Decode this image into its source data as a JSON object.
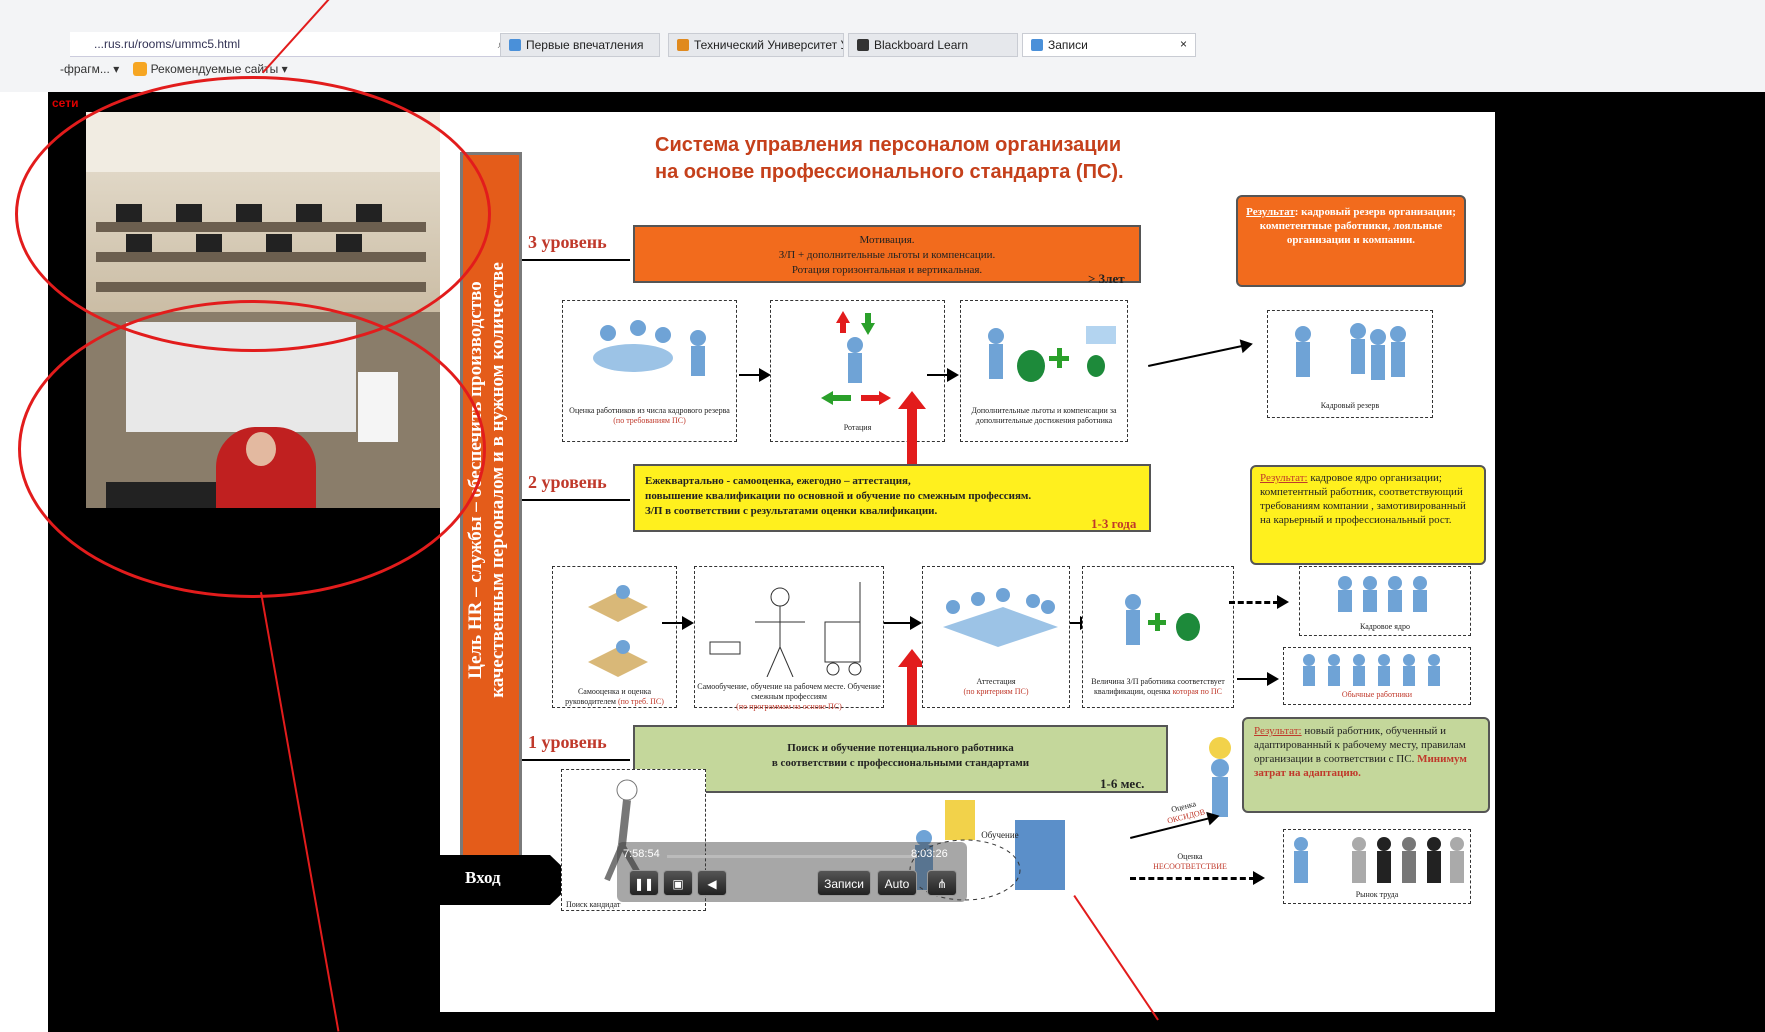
{
  "browser": {
    "address": "...rus.ru/rooms/ummc5.html",
    "tabs": [
      {
        "label": "Первые впечатления",
        "active": false
      },
      {
        "label": "Технический Университет УГ...",
        "active": false
      },
      {
        "label": "Blackboard Learn",
        "active": false
      },
      {
        "label": "Записи",
        "active": true
      }
    ],
    "favorites_left": "-фрагм...",
    "favorites_item": "Рекомендуемые сайты",
    "close_tab": "×"
  },
  "room_link": "сети",
  "slide": {
    "title_line1": "Система управления персоналом организации",
    "title_line2": "на основе профессионального стандарта (ПС).",
    "goal_line1": "Цель HR – службы – обеспечить производство",
    "goal_line2": "качественным персоналом и в нужном количестве",
    "entry": "Вход",
    "level3": {
      "label": "3 уровень",
      "lines": [
        "Мотивация.",
        "З/П + дополнительные льготы и компенсации.",
        "Ротация горизонтальная и вертикальная."
      ],
      "term": "> 3лет"
    },
    "level2": {
      "label": "2 уровень",
      "lines": [
        "Ежеквартально - самооценка, ежегодно – аттестация,",
        "повышение квалификации по основной и обучение по смежным профессиям.",
        "З/П в соответствии с результатами оценки квалификации."
      ],
      "term": "1-3 года"
    },
    "level1": {
      "label": "1 уровень",
      "lines": [
        "Поиск и обучение потенциального работника",
        "в соответствии с профессиональными стандартами"
      ],
      "term": "1-6 мес."
    },
    "result3": {
      "head": "Результат",
      "text": ": кадровый резерв организации; компетентные работники, лояльные организации и компании."
    },
    "result2": {
      "head": "Результат:",
      "text": " кадровое ядро организации; компетентный работник, соответствующий требованиям компании , замотивированный на карьерный и профессиональный рост."
    },
    "result1": {
      "head": "Результат:",
      "text": " новый работник, обученный и адаптированный к рабочему месту, правилам организации в соответствии с ПС.",
      "extra": "Минимум затрат на адаптацию."
    },
    "captions": {
      "eval": "Оценка работников из числа кадрового резерва",
      "eval_red": "(по требованиям ПС)",
      "rotation": "Ротация",
      "benefits": "Дополнительные льготы и компенсации за дополнительные достижения работника",
      "reserve": "Кадровый резерв",
      "selfeval": "Самооценка и оценка руководителем",
      "selfeval_red": "(по треб. ПС)",
      "training": "Самообучение, обучение на рабочем месте. Обучение смежным профессиям",
      "training_red": "(по программам на основе ПС)",
      "attest": "Аттестация",
      "attest_red": "(по критериям ПС)",
      "salary": "Величина З/П работника соответствует квалификации, оценка",
      "salary_red": "которая по ПС",
      "core": "Кадровое ядро",
      "regular": "Обычные работники",
      "training2": "Обучение",
      "assess": "Оценка",
      "assess_red": "ОКСИДОВ",
      "assess2": "Оценка",
      "assess2_red": "НЕСООТВЕТСТВИЕ",
      "market": "Рынок труда",
      "search": "Поиск кандидат"
    }
  },
  "player": {
    "time_start": "7:58:54",
    "time_end": "8:03:26",
    "btn_records": "Записи",
    "btn_auto": "Auto"
  }
}
